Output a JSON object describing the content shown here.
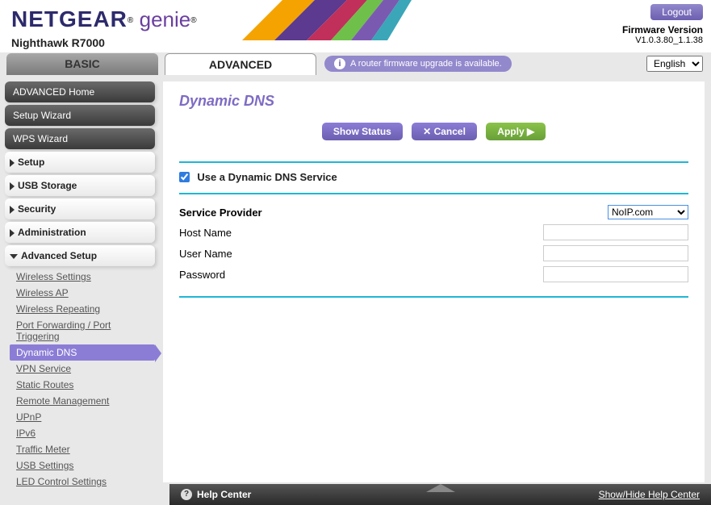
{
  "header": {
    "brand1": "NETGEAR",
    "brand2": "genie",
    "device": "Nighthawk R7000",
    "logout": "Logout",
    "fw_label": "Firmware Version",
    "fw_version": "V1.0.3.80_1.1.38"
  },
  "tabs": {
    "basic": "BASIC",
    "advanced": "ADVANCED"
  },
  "notice": "A router firmware upgrade is available.",
  "language": {
    "selected": "English",
    "options": [
      "English"
    ]
  },
  "sidebar": {
    "home": "ADVANCED Home",
    "setup_wizard": "Setup Wizard",
    "wps_wizard": "WPS Wizard",
    "setup": "Setup",
    "usb_storage": "USB Storage",
    "security": "Security",
    "administration": "Administration",
    "adv_setup": "Advanced Setup",
    "sub": [
      "Wireless Settings",
      "Wireless AP",
      "Wireless Repeating",
      "Port Forwarding / Port Triggering",
      "Dynamic DNS",
      "VPN Service",
      "Static Routes",
      "Remote Management",
      "UPnP",
      "IPv6",
      "Traffic Meter",
      "USB Settings",
      "LED Control Settings"
    ]
  },
  "page": {
    "title": "Dynamic DNS",
    "btn_status": "Show Status",
    "btn_cancel": "Cancel",
    "btn_apply": "Apply ▶",
    "checkbox_label": "Use a Dynamic DNS Service",
    "fields": {
      "provider_label": "Service Provider",
      "provider_value": "NoIP.com",
      "host_label": "Host Name",
      "user_label": "User Name",
      "pass_label": "Password"
    }
  },
  "footer": {
    "help_center": "Help Center",
    "show_hide": "Show/Hide Help Center"
  }
}
